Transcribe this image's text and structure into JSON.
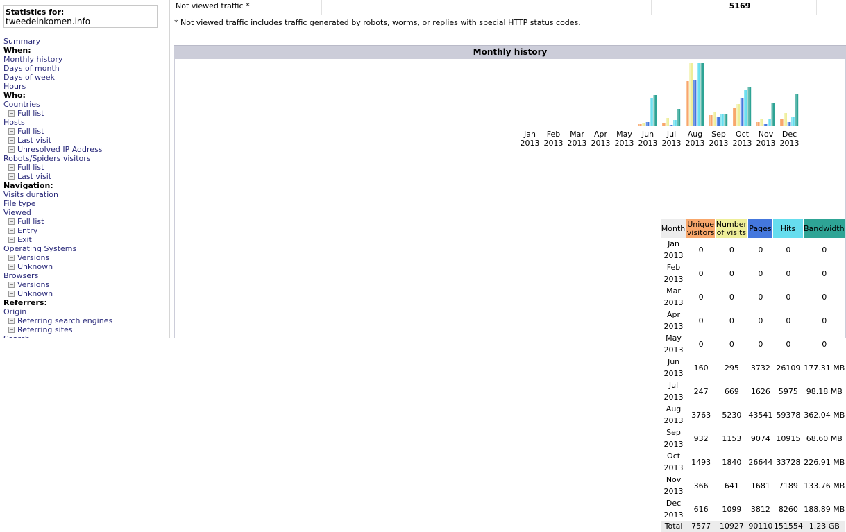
{
  "menu": {
    "title": "Statistics for:",
    "site": "tweedeinkomen.info",
    "items": [
      {
        "label": "Summary",
        "kind": "link"
      },
      {
        "label": "When:",
        "kind": "header"
      },
      {
        "label": "Monthly history",
        "kind": "link"
      },
      {
        "label": "Days of month",
        "kind": "link"
      },
      {
        "label": "Days of week",
        "kind": "link"
      },
      {
        "label": "Hours",
        "kind": "link"
      },
      {
        "label": "Who:",
        "kind": "header"
      },
      {
        "label": "Countries",
        "kind": "link"
      },
      {
        "label": "Full list",
        "kind": "sub"
      },
      {
        "label": "Hosts",
        "kind": "link"
      },
      {
        "label": "Full list",
        "kind": "sub"
      },
      {
        "label": "Last visit",
        "kind": "sub"
      },
      {
        "label": "Unresolved IP Address",
        "kind": "sub"
      },
      {
        "label": "Robots/Spiders visitors",
        "kind": "link"
      },
      {
        "label": "Full list",
        "kind": "sub"
      },
      {
        "label": "Last visit",
        "kind": "sub"
      },
      {
        "label": "Navigation:",
        "kind": "header"
      },
      {
        "label": "Visits duration",
        "kind": "link"
      },
      {
        "label": "File type",
        "kind": "link"
      },
      {
        "label": "Viewed",
        "kind": "link"
      },
      {
        "label": "Full list",
        "kind": "sub"
      },
      {
        "label": "Entry",
        "kind": "sub"
      },
      {
        "label": "Exit",
        "kind": "sub"
      },
      {
        "label": "Operating Systems",
        "kind": "link"
      },
      {
        "label": "Versions",
        "kind": "sub"
      },
      {
        "label": "Unknown",
        "kind": "sub"
      },
      {
        "label": "Browsers",
        "kind": "link"
      },
      {
        "label": "Versions",
        "kind": "sub"
      },
      {
        "label": "Unknown",
        "kind": "sub"
      },
      {
        "label": "Referrers:",
        "kind": "header"
      },
      {
        "label": "Origin",
        "kind": "link"
      },
      {
        "label": "Referring search engines",
        "kind": "sub"
      },
      {
        "label": "Referring sites",
        "kind": "sub"
      },
      {
        "label": "Search",
        "kind": "link"
      }
    ]
  },
  "traffic": {
    "not_viewed_label": "Not viewed traffic *",
    "not_viewed_value": "5169",
    "note": "* Not viewed traffic includes traffic generated by robots, worms, or replies with special HTTP status codes."
  },
  "monthly": {
    "title": "Monthly history",
    "headers": {
      "month": "Month",
      "unique": "Unique visitors",
      "visits": "Number of visits",
      "pages": "Pages",
      "hits": "Hits",
      "bandwidth": "Bandwidth"
    },
    "rows": [
      {
        "month": "Jan 2013",
        "unique": "0",
        "visits": "0",
        "pages": "0",
        "hits": "0",
        "bandwidth": "0"
      },
      {
        "month": "Feb 2013",
        "unique": "0",
        "visits": "0",
        "pages": "0",
        "hits": "0",
        "bandwidth": "0"
      },
      {
        "month": "Mar 2013",
        "unique": "0",
        "visits": "0",
        "pages": "0",
        "hits": "0",
        "bandwidth": "0"
      },
      {
        "month": "Apr 2013",
        "unique": "0",
        "visits": "0",
        "pages": "0",
        "hits": "0",
        "bandwidth": "0"
      },
      {
        "month": "May 2013",
        "unique": "0",
        "visits": "0",
        "pages": "0",
        "hits": "0",
        "bandwidth": "0"
      },
      {
        "month": "Jun 2013",
        "unique": "160",
        "visits": "295",
        "pages": "3732",
        "hits": "26109",
        "bandwidth": "177.31 MB"
      },
      {
        "month": "Jul 2013",
        "unique": "247",
        "visits": "669",
        "pages": "1626",
        "hits": "5975",
        "bandwidth": "98.18 MB"
      },
      {
        "month": "Aug 2013",
        "unique": "3763",
        "visits": "5230",
        "pages": "43541",
        "hits": "59378",
        "bandwidth": "362.04 MB"
      },
      {
        "month": "Sep 2013",
        "unique": "932",
        "visits": "1153",
        "pages": "9074",
        "hits": "10915",
        "bandwidth": "68.60 MB"
      },
      {
        "month": "Oct 2013",
        "unique": "1493",
        "visits": "1840",
        "pages": "26644",
        "hits": "33728",
        "bandwidth": "226.91 MB"
      },
      {
        "month": "Nov 2013",
        "unique": "366",
        "visits": "641",
        "pages": "1681",
        "hits": "7189",
        "bandwidth": "133.76 MB"
      },
      {
        "month": "Dec 2013",
        "unique": "616",
        "visits": "1099",
        "pages": "3812",
        "hits": "8260",
        "bandwidth": "188.89 MB"
      }
    ],
    "total": {
      "month": "Total",
      "unique": "7577",
      "visits": "10927",
      "pages": "90110",
      "hits": "151554",
      "bandwidth": "1.23 GB"
    },
    "colors": {
      "unique": "#f8a76b",
      "visits": "#eeee99",
      "pages": "#4477dd",
      "hits": "#66ddee",
      "bandwidth": "#2ea495",
      "month_header": "#ececec"
    }
  },
  "chart_data": {
    "type": "bar",
    "categories": [
      "Jan 2013",
      "Feb 2013",
      "Mar 2013",
      "Apr 2013",
      "May 2013",
      "Jun 2013",
      "Jul 2013",
      "Aug 2013",
      "Sep 2013",
      "Oct 2013",
      "Nov 2013",
      "Dec 2013"
    ],
    "month_labels": [
      "Jan",
      "Feb",
      "Mar",
      "Apr",
      "May",
      "Jun",
      "Jul",
      "Aug",
      "Sep",
      "Oct",
      "Nov",
      "Dec"
    ],
    "year_labels": [
      "2013",
      "2013",
      "2013",
      "2013",
      "2013",
      "2013",
      "2013",
      "2013",
      "2013",
      "2013",
      "2013",
      "2013"
    ],
    "series": [
      {
        "name": "Unique visitors",
        "key": "unique",
        "values": [
          0,
          0,
          0,
          0,
          0,
          160,
          247,
          3763,
          932,
          1493,
          366,
          616
        ]
      },
      {
        "name": "Number of visits",
        "key": "visits",
        "values": [
          0,
          0,
          0,
          0,
          0,
          295,
          669,
          5230,
          1153,
          1840,
          641,
          1099
        ]
      },
      {
        "name": "Pages",
        "key": "pages",
        "values": [
          0,
          0,
          0,
          0,
          0,
          3732,
          1626,
          43541,
          9074,
          26644,
          1681,
          3812
        ]
      },
      {
        "name": "Hits",
        "key": "hits",
        "values": [
          0,
          0,
          0,
          0,
          0,
          26109,
          5975,
          59378,
          10915,
          33728,
          7189,
          8260
        ]
      },
      {
        "name": "Bandwidth",
        "key": "bandwidth",
        "values": [
          0,
          0,
          0,
          0,
          0,
          177.31,
          98.18,
          362.04,
          68.6,
          226.91,
          133.76,
          188.89
        ]
      }
    ],
    "grid": false,
    "legend": "none"
  }
}
